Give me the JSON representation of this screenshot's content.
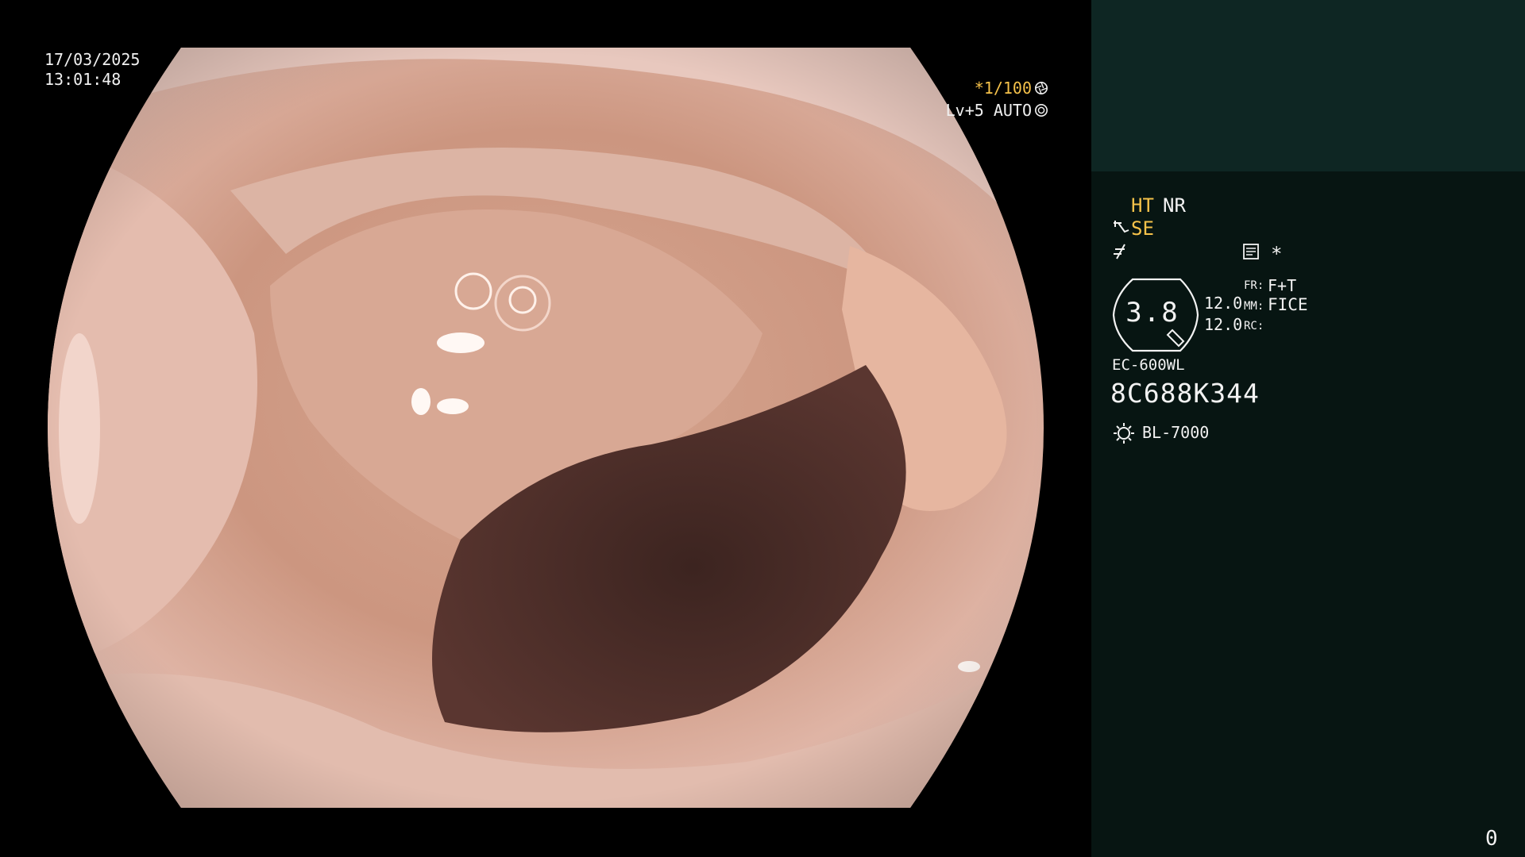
{
  "osd": {
    "date": "17/03/2025",
    "time": "13:01:48",
    "shutter": "*1/100",
    "shutter_icon": "aperture-icon",
    "iris_level": "Lv+5",
    "iris_mode": "AUTO",
    "iris_icon": "iris-icon"
  },
  "panel": {
    "ht_label": "HT",
    "nr_label": "NR",
    "se_label": "SE",
    "se_icon": "scope-enhance-icon",
    "freeze_icon": "freeze-icon",
    "memo_icon": "memo-icon",
    "asterisk": "*",
    "zoom_value": "3.8",
    "value_top": "12.0",
    "value_bottom": "12.0",
    "fr_label": "FR:",
    "fr_value": "F+T",
    "mm_label": "MM:",
    "mm_value": "FICE",
    "rc_label": "RC:",
    "scope_model": "EC-600WL",
    "scope_serial": "8C688K344",
    "light_icon": "light-source-icon",
    "light_source": "BL-7000"
  },
  "footer": {
    "frame_counter": "0"
  },
  "colors": {
    "background": "#000000",
    "panel_background": "#071512",
    "patient_box": "#0e2623",
    "accent_amber": "#f6c24a",
    "text": "#f2f2f2"
  }
}
